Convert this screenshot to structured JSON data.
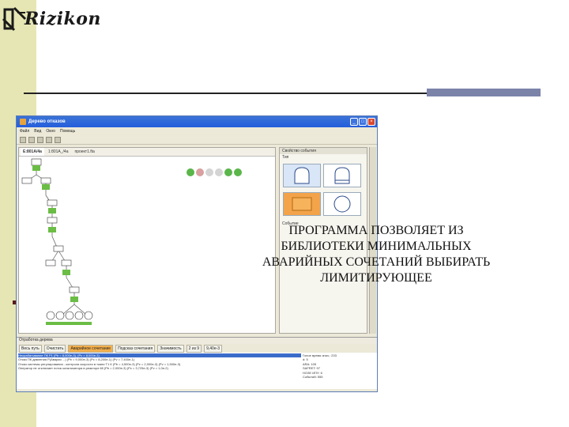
{
  "slide": {
    "logo_text": "Rizikon",
    "overlay_lines": [
      "ПРОГРАММА ПОЗВОЛЯЕТ ИЗ",
      "БИБЛИОТЕКИ МИНИМАЛЬНЫХ",
      "АВАРИЙНЫХ СОЧЕТАНИЙ ВЫБИРАТЬ",
      "ЛИМИТИРУЮЩЕЕ"
    ]
  },
  "app": {
    "title": "Дерево отказов",
    "menu": [
      "Файл",
      "Вид",
      "Окно",
      "Помощь"
    ],
    "doc_tabs": [
      "E:801A/4a",
      "1:801A_/4a",
      "проект1.fta"
    ],
    "property_panel": {
      "title": "Свойство события",
      "type_label": "Тип",
      "event_label": "Событие"
    },
    "bottom": {
      "title": "Отработка дерева",
      "tabs": [
        "Весь путь",
        "Очистить",
        "Аварийное сочетание",
        "Подсказ сочетания",
        "Значимость"
      ],
      "counter": "2 из 9",
      "value_field": "9,40e-3",
      "log_lines": [
        "Несрабатывание ПК P1 (Pb = 8,000e-3), (Pc = 8,000e-3)",
        "Отказ ПК давления P(Аварии ...) (Pb = 9,000e-3) (Pc = 8,200e-1) (Pv = 7,400e-1)",
        "Отказ системы регулирования - контроля скорости в ткани T1 К (Pb = 4,500e-3) (Pc = 2,000e-3) (Pv = 1,500e-3)",
        "Оператор не отключает поток катализатора в реакторе ll8 (Pb = 2,000e-3) (Pc = 3,725e-3) (Pv = 1,0e-2)"
      ],
      "stats": [
        "Голое время знач.: 233",
        "d: 5",
        "ARA: 105",
        "SAFRET: 97",
        "HОЗЕ ИПУ: 6",
        "Событий: 555"
      ]
    }
  }
}
